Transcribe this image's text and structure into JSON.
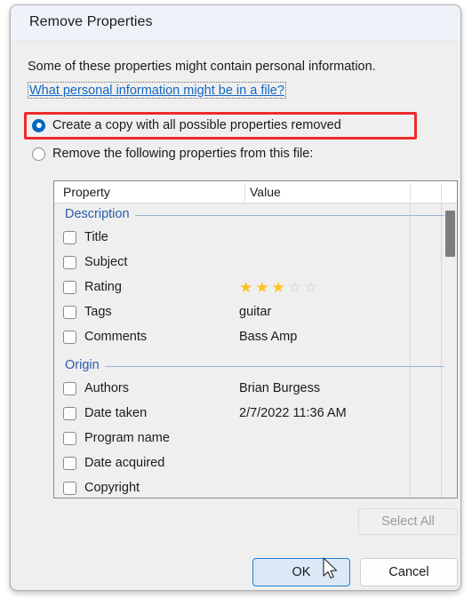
{
  "dialog": {
    "title": "Remove Properties",
    "intro": "Some of these properties might contain personal information.",
    "help_link": "What personal information might be in a file?"
  },
  "options": {
    "create_copy": {
      "label": "Create a copy with all possible properties removed",
      "selected": true,
      "highlighted": true
    },
    "remove_following": {
      "label": "Remove the following properties from this file:",
      "selected": false
    }
  },
  "property_list": {
    "columns": [
      "Property",
      "Value"
    ],
    "groups": [
      {
        "name": "Description",
        "rows": [
          {
            "name": "Title",
            "value": "",
            "checked": false
          },
          {
            "name": "Subject",
            "value": "",
            "checked": false
          },
          {
            "name": "Rating",
            "value": "",
            "checked": false,
            "stars": {
              "filled": 3,
              "total": 5
            }
          },
          {
            "name": "Tags",
            "value": "guitar",
            "checked": false
          },
          {
            "name": "Comments",
            "value": "Bass Amp",
            "checked": false
          }
        ]
      },
      {
        "name": "Origin",
        "rows": [
          {
            "name": "Authors",
            "value": "Brian Burgess",
            "checked": false
          },
          {
            "name": "Date taken",
            "value": "2/7/2022 11:36 AM",
            "checked": false
          },
          {
            "name": "Program name",
            "value": "",
            "checked": false
          },
          {
            "name": "Date acquired",
            "value": "",
            "checked": false
          },
          {
            "name": "Copyright",
            "value": "",
            "checked": false
          }
        ]
      }
    ]
  },
  "buttons": {
    "select_all": {
      "label": "Select All",
      "enabled": false
    },
    "ok": {
      "label": "OK",
      "default": true
    },
    "cancel": {
      "label": "Cancel"
    }
  },
  "colors": {
    "accent_blue": "#0067c0",
    "link_blue": "#1467c8",
    "group_blue": "#2a5caa",
    "star_gold": "#ffc122",
    "star_empty": "#c9c9c9",
    "highlight_red": "#ef2b2b",
    "dialog_bg": "#efefef",
    "titlebar_bg": "#eef2f9"
  },
  "icons": {
    "star_filled": "★",
    "star_empty": "☆"
  }
}
